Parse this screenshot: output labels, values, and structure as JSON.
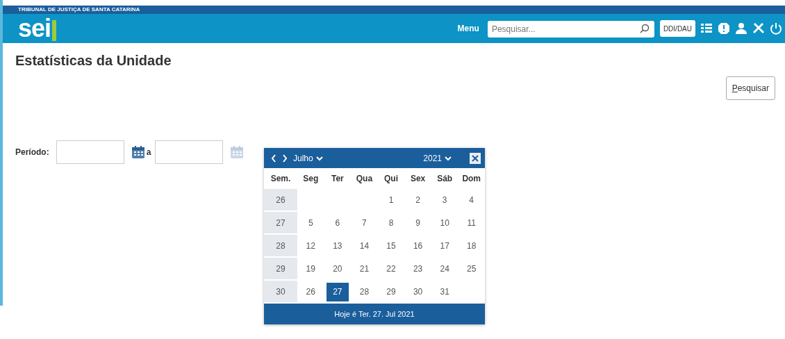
{
  "header": {
    "org": "TRIBUNAL DE JUSTIÇA DE SANTA CATARINA",
    "logo": "sei",
    "menu": "Menu",
    "search": {
      "placeholder": "Pesquisar..."
    },
    "unit": "DDI/DAU"
  },
  "page": {
    "title": "Estatísticas da Unidade",
    "search_button": "Pesquisar"
  },
  "period": {
    "label": "Período:",
    "separator": "a"
  },
  "calendar": {
    "month": "Julho",
    "year": "2021",
    "headers": [
      "Sem.",
      "Seg",
      "Ter",
      "Qua",
      "Qui",
      "Sex",
      "Sáb",
      "Dom"
    ],
    "weeks": [
      {
        "week": "26",
        "kind": "partial-start",
        "days": [
          {
            "day": "1",
            "selected": false
          },
          {
            "day": "2",
            "selected": false
          },
          {
            "day": "3",
            "selected": false
          },
          {
            "day": "4",
            "selected": false
          }
        ]
      },
      {
        "week": "27",
        "kind": "full",
        "days": [
          {
            "day": "5",
            "selected": false
          },
          {
            "day": "6",
            "selected": false
          },
          {
            "day": "7",
            "selected": false
          },
          {
            "day": "8",
            "selected": false
          },
          {
            "day": "9",
            "selected": false
          },
          {
            "day": "10",
            "selected": false
          },
          {
            "day": "11",
            "selected": false
          }
        ]
      },
      {
        "week": "28",
        "kind": "full",
        "days": [
          {
            "day": "12",
            "selected": false
          },
          {
            "day": "13",
            "selected": false
          },
          {
            "day": "14",
            "selected": false
          },
          {
            "day": "15",
            "selected": false
          },
          {
            "day": "16",
            "selected": false
          },
          {
            "day": "17",
            "selected": false
          },
          {
            "day": "18",
            "selected": false
          }
        ]
      },
      {
        "week": "29",
        "kind": "full",
        "days": [
          {
            "day": "19",
            "selected": false
          },
          {
            "day": "20",
            "selected": false
          },
          {
            "day": "21",
            "selected": false
          },
          {
            "day": "22",
            "selected": false
          },
          {
            "day": "23",
            "selected": false
          },
          {
            "day": "24",
            "selected": false
          },
          {
            "day": "25",
            "selected": false
          }
        ]
      },
      {
        "week": "30",
        "kind": "partial-end",
        "days": [
          {
            "day": "26",
            "selected": false
          },
          {
            "day": "27",
            "selected": true
          },
          {
            "day": "28",
            "selected": false
          },
          {
            "day": "29",
            "selected": false
          },
          {
            "day": "30",
            "selected": false
          },
          {
            "day": "31",
            "selected": false
          }
        ]
      }
    ],
    "today": "Hoje é Ter. 27. Jul 2021"
  }
}
